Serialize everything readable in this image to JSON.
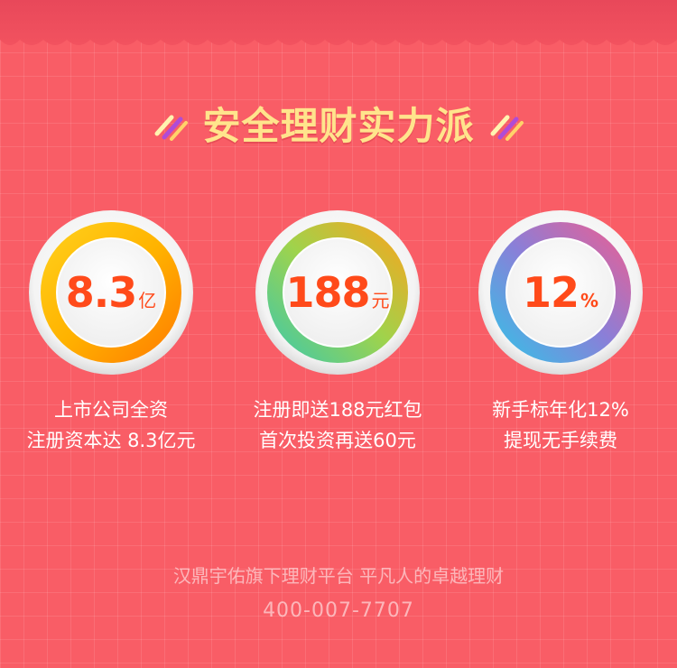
{
  "colors": {
    "background": "#f95d66",
    "title": "#ffe48c",
    "value_text": "#ff4a1a",
    "desc_text": "#ffffff"
  },
  "title": "安全理财实力派",
  "stats": [
    {
      "value": "8.3",
      "unit": "亿",
      "lines": [
        "上市公司全资",
        "注册资本达 8.3亿元"
      ]
    },
    {
      "value": "188",
      "unit": "元",
      "lines": [
        "注册即送188元红包",
        "首次投资再送60元"
      ]
    },
    {
      "value": "12",
      "unit": "%",
      "lines": [
        "新手标年化12%",
        "提现无手续费"
      ]
    }
  ],
  "footer": {
    "slogan": "汉鼎宇佑旗下理财平台 平凡人的卓越理财",
    "phone": "400-007-7707"
  }
}
